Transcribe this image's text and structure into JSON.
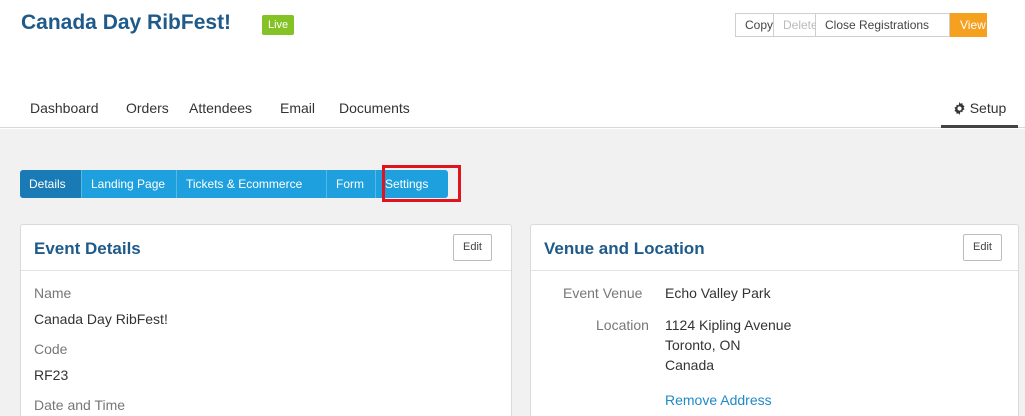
{
  "header": {
    "title": "Canada Day RibFest!",
    "status_badge": "Live",
    "buttons": {
      "copy": "Copy",
      "delete": "Delete",
      "close_registrations": "Close Registrations",
      "view": "View"
    }
  },
  "nav": {
    "items": [
      "Dashboard",
      "Orders",
      "Attendees",
      "Email",
      "Documents"
    ],
    "setup": "Setup"
  },
  "tabs": [
    "Details",
    "Landing Page",
    "Tickets & Ecommerce",
    "Form",
    "Settings"
  ],
  "event_details": {
    "title": "Event Details",
    "edit": "Edit",
    "name_label": "Name",
    "name_value": "Canada Day RibFest!",
    "code_label": "Code",
    "code_value": "RF23",
    "date_label": "Date and Time"
  },
  "venue": {
    "title": "Venue and Location",
    "edit": "Edit",
    "venue_label": "Event Venue",
    "venue_value": "Echo Valley Park",
    "location_label": "Location",
    "address_line1": "1124 Kipling Avenue",
    "address_line2": "Toronto, ON",
    "address_line3": "Canada",
    "remove_address": "Remove Address"
  },
  "colors": {
    "title": "#1e5a8a",
    "live": "#84c225",
    "view_button": "#f5a01e",
    "tab": "#1ea0de",
    "tab_active": "#1a7ab5",
    "highlight": "#e0141e",
    "link": "#1e8ac6"
  }
}
